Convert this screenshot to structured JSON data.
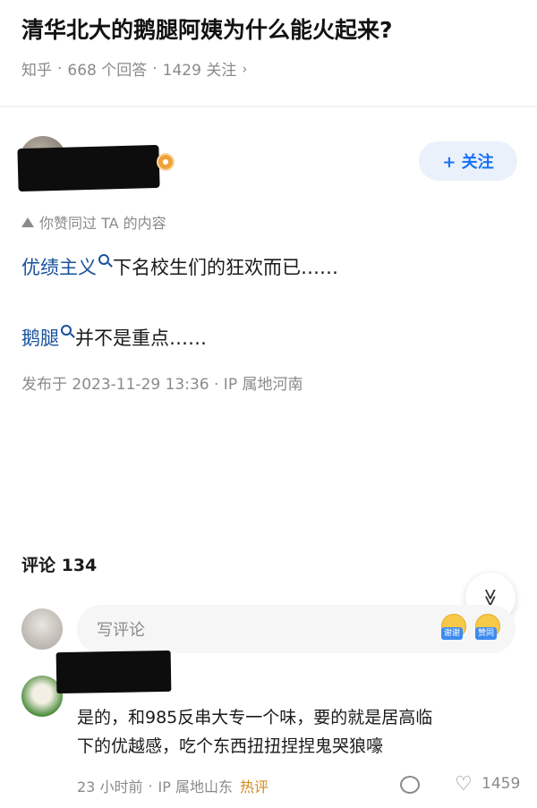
{
  "question": {
    "title": "清华北大的鹅腿阿姨为什么能火起来?",
    "source": "知乎",
    "answers": "668 个回答",
    "followers": "1429 关注",
    "chevron": "›"
  },
  "author": {
    "follow_label": "+ 关注",
    "liked_hint": "你赞同过 TA 的内容"
  },
  "answer": {
    "p1_keyword": "优绩主义",
    "p1_rest": "下名校生们的狂欢而已……",
    "p2_keyword": "鹅腿",
    "p2_rest": "并不是重点……",
    "published": "发布于 2023-11-29 13:36 · IP 属地河南"
  },
  "comments": {
    "title": "评论 134",
    "collapse_icon": "≫",
    "input_placeholder": "写评论",
    "emoji_tags": [
      "谢谢",
      "赞同"
    ],
    "items": [
      {
        "line1": "是的，和985反串大专一个味，要的就是居高临",
        "line2": "下的优越感，吃个东西扭扭捏捏鬼哭狼嚎",
        "time": "23 小时前",
        "ip": "IP 属地山东",
        "hot": "热评",
        "likes": "1459"
      }
    ]
  },
  "colors": {
    "link": "#175199",
    "brand_blue": "#1772f6",
    "hot": "#d18a1c",
    "meta": "#8a8a8a"
  }
}
